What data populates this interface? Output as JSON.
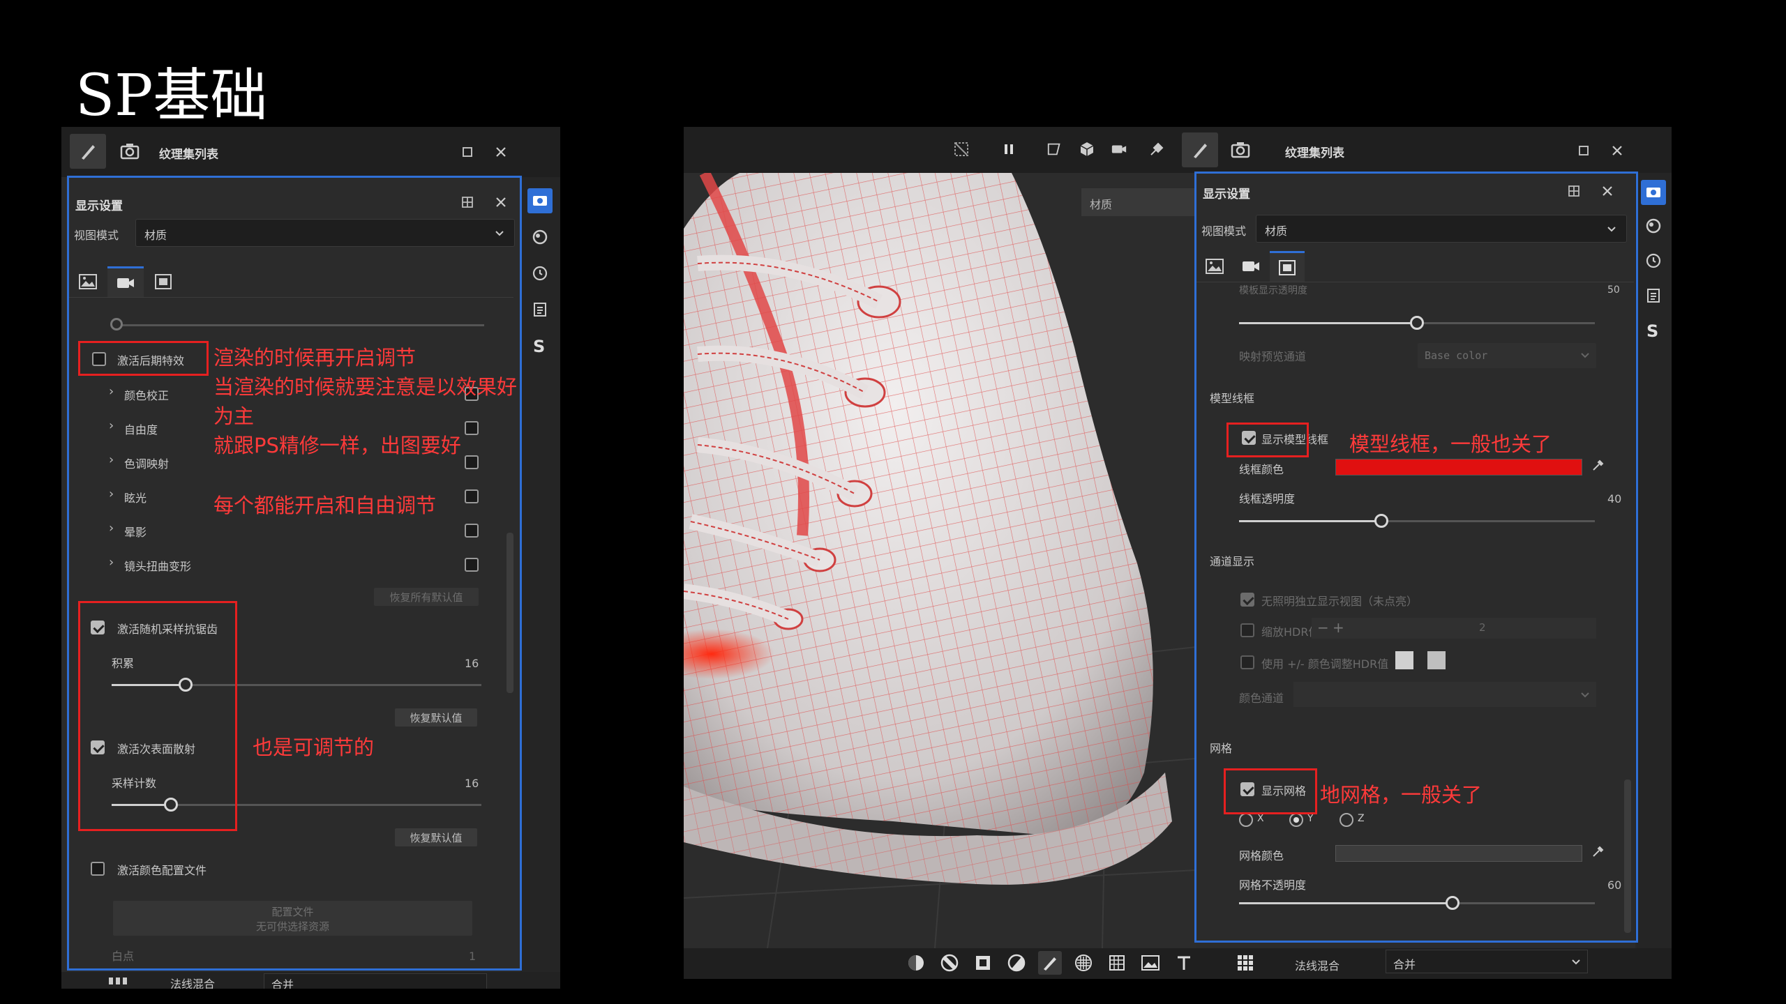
{
  "slide": {
    "title": "SP基础"
  },
  "left": {
    "header_tab": "纹理集列表",
    "panel_title": "显示设置",
    "view_mode_label": "视图模式",
    "view_mode_value": "材质",
    "post_fx": {
      "label": "激活后期特效",
      "checked": false
    },
    "post_items": [
      {
        "label": "颜色校正",
        "checked": false
      },
      {
        "label": "自由度",
        "checked": false
      },
      {
        "label": "色调映射",
        "checked": false
      },
      {
        "label": "眩光",
        "checked": false
      },
      {
        "label": "晕影",
        "checked": false
      },
      {
        "label": "镜头扭曲变形",
        "checked": false
      }
    ],
    "restore_all": "恢复所有默认值",
    "aa": {
      "label": "激活随机采样抗锯齿",
      "checked": true,
      "sub_label": "积累",
      "value": "16",
      "fraction": 0.2,
      "reset": "恢复默认值"
    },
    "sss": {
      "label": "激活次表面散射",
      "checked": true,
      "sub_label": "采样计数",
      "value": "16",
      "fraction": 0.16,
      "reset": "恢复默认值"
    },
    "color_profile": {
      "label": "激活颜色配置文件",
      "checked": false
    },
    "config_file_btn": {
      "line1": "配置文件",
      "line2": "无可供选择资源"
    },
    "white_point": {
      "label": "白点",
      "value": "1"
    },
    "bottom_label": "法线混合",
    "bottom_value": "合并"
  },
  "right": {
    "header_tab": "纹理集列表",
    "viewport_label": "材质",
    "panel_title": "显示设置",
    "view_mode_label": "视图模式",
    "view_mode_value": "材质",
    "top_slider": {
      "label": "模板显示透明度",
      "value": "50",
      "fraction": 0.5
    },
    "map_channel": {
      "label": "映射预览通道",
      "value": "Base color"
    },
    "wireframe_section": "模型线框",
    "show_wireframe": {
      "label": "显示模型线框",
      "checked": true
    },
    "wire_color_label": "线框颜色",
    "wire_color": "#e01010",
    "wire_opacity": {
      "label": "线框透明度",
      "value": "40",
      "fraction": 0.4
    },
    "channel_section": "通道显示",
    "channel_opt1": {
      "label": "无照明独立显示视图（未点亮）",
      "checked": true
    },
    "channel_opt2": {
      "label": "缩放HDR值",
      "value": "2",
      "minus": "−",
      "plus": "+",
      "checked": false
    },
    "channel_opt3": {
      "label": "使用 +/- 颜色调整HDR值",
      "checked": false
    },
    "color_channel_label": "颜色通道",
    "grid_section": "网格",
    "show_grid": {
      "label": "显示网格",
      "checked": true
    },
    "axes": [
      {
        "label": "X",
        "on": false
      },
      {
        "label": "Y",
        "on": true
      },
      {
        "label": "Z",
        "on": false
      }
    ],
    "grid_color_label": "网格颜色",
    "grid_color": "#3c3c3c",
    "grid_opacity": {
      "label": "网格不透明度",
      "value": "60",
      "fraction": 0.6
    },
    "bottom_label": "法线混合",
    "bottom_value": "合并"
  },
  "annotations": {
    "a1": "渲染的时候再开启调节",
    "a2": "当渲染的时候就要注意是以效果好",
    "a3": "为主",
    "a4": "就跟PS精修一样，出图要好",
    "a5": "每个都能开启和自由调节",
    "a6": "也是可调节的",
    "a7": "模型线框，一般也关了",
    "a8": "地网格，一般关了"
  }
}
